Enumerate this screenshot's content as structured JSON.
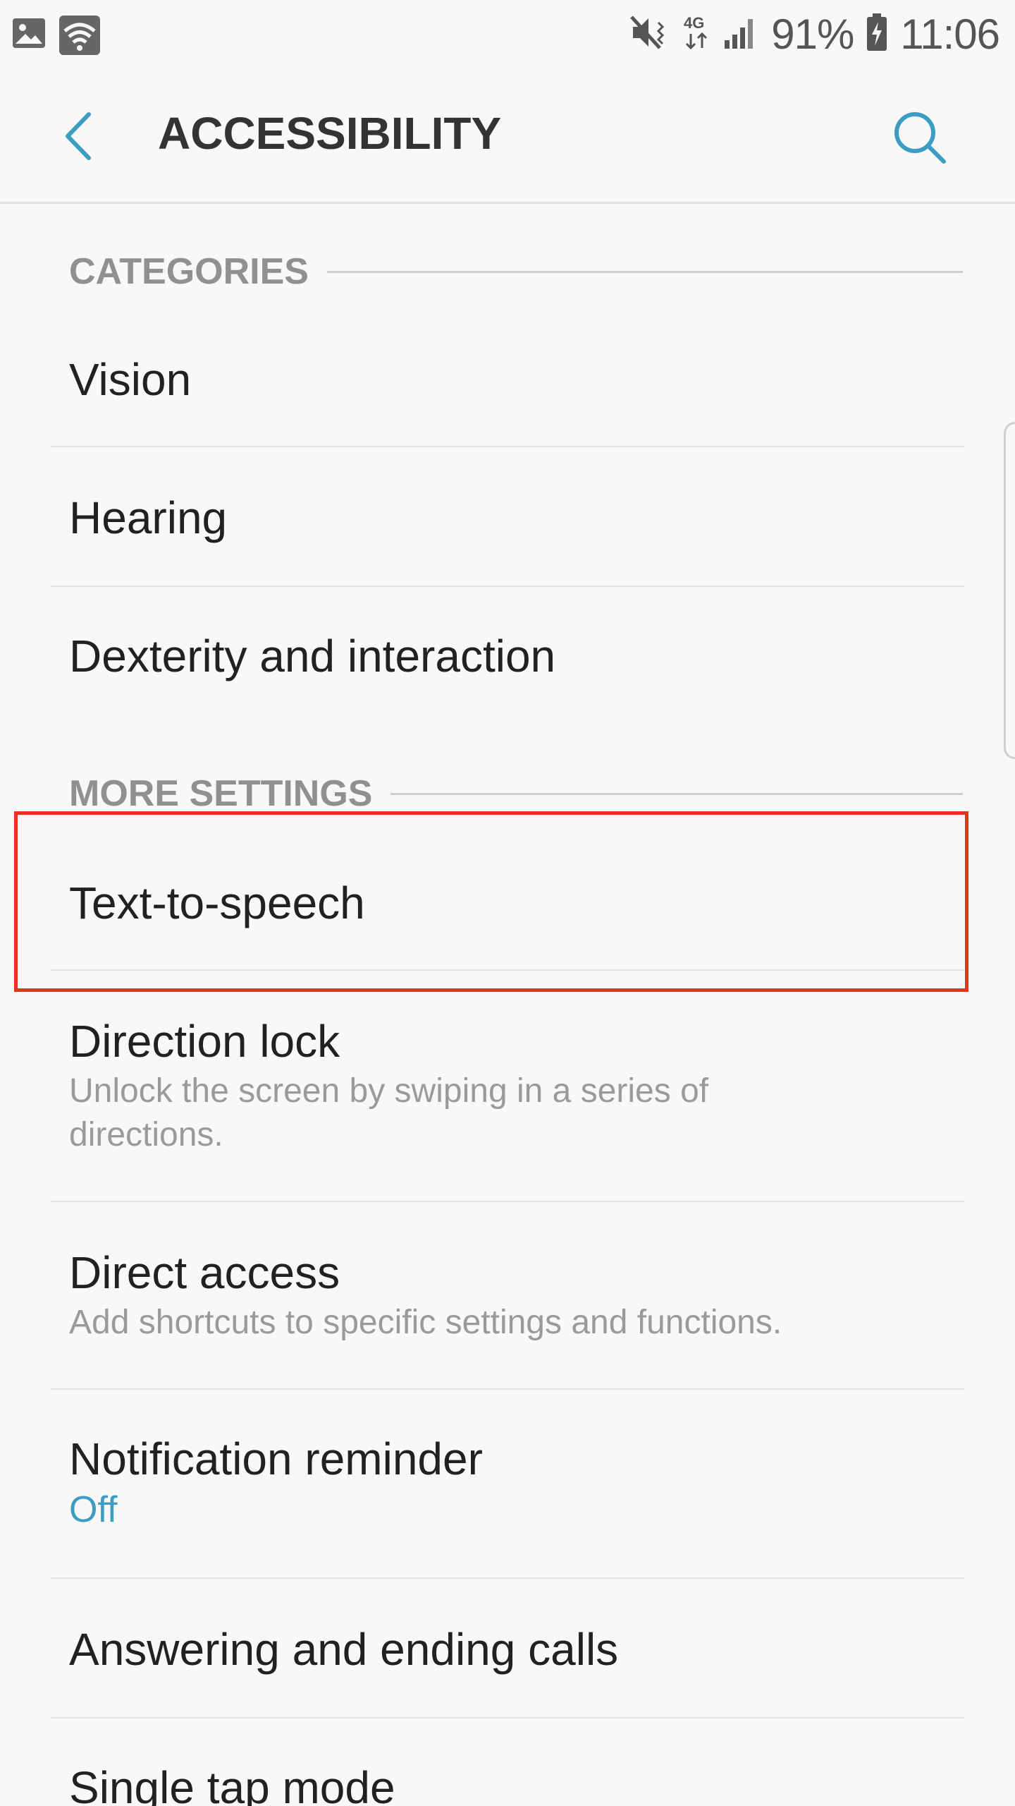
{
  "status_bar": {
    "battery": "91%",
    "time": "11:06",
    "network": "4G",
    "icons": [
      "image-icon",
      "wifi-icon",
      "mute-vibrate-icon",
      "network-4g-icon",
      "signal-icon",
      "battery-charging-icon"
    ]
  },
  "app_bar": {
    "title": "ACCESSIBILITY",
    "back_icon": "chevron-left-icon",
    "search_icon": "search-icon"
  },
  "sections": {
    "categories": "CATEGORIES",
    "more_settings": "MORE SETTINGS"
  },
  "items": [
    {
      "title": "Vision"
    },
    {
      "title": "Hearing"
    },
    {
      "title": "Dexterity and interaction"
    },
    {
      "title": "Text-to-speech"
    },
    {
      "title": "Direction lock",
      "subtitle": "Unlock the screen by swiping in a series of directions."
    },
    {
      "title": "Direct access",
      "subtitle": "Add shortcuts to specific settings and functions."
    },
    {
      "title": "Notification reminder",
      "status": "Off"
    },
    {
      "title": "Answering and ending calls"
    },
    {
      "title": "Single tap mode"
    }
  ],
  "colors": {
    "accent": "#3d9cc2",
    "highlight": "#e8321e",
    "background": "#f8f8f8"
  }
}
